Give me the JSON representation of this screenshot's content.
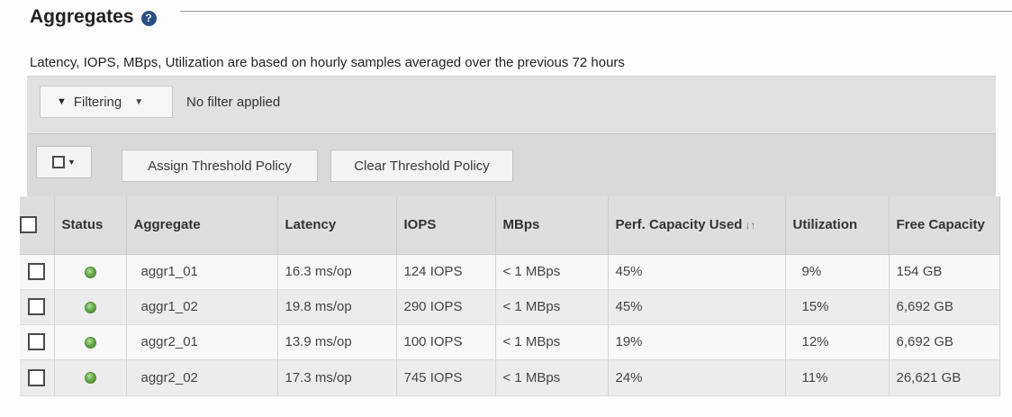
{
  "header": {
    "title": "Aggregates",
    "help_icon": "help-icon",
    "subtitle": "Latency, IOPS, MBps, Utilization are based on hourly samples averaged over the previous 72 hours"
  },
  "filter": {
    "button_label": "Filtering",
    "status": "No filter applied"
  },
  "actions": {
    "assign_label": "Assign Threshold Policy",
    "clear_label": "Clear Threshold Policy"
  },
  "table": {
    "columns": [
      "Status",
      "Aggregate",
      "Latency",
      "IOPS",
      "MBps",
      "Perf. Capacity Used",
      "Utilization",
      "Free Capacity"
    ],
    "rows": [
      {
        "status": "ok",
        "aggregate": "aggr1_01",
        "latency": "16.3 ms/op",
        "iops": "124 IOPS",
        "mbps": "< 1 MBps",
        "perf_capacity": "45%",
        "utilization": "9%",
        "free_capacity": "154 GB"
      },
      {
        "status": "ok",
        "aggregate": "aggr1_02",
        "latency": "19.8 ms/op",
        "iops": "290 IOPS",
        "mbps": "< 1 MBps",
        "perf_capacity": "45%",
        "utilization": "15%",
        "free_capacity": "6,692 GB"
      },
      {
        "status": "ok",
        "aggregate": "aggr2_01",
        "latency": "13.9 ms/op",
        "iops": "100 IOPS",
        "mbps": "< 1 MBps",
        "perf_capacity": "19%",
        "utilization": "12%",
        "free_capacity": "6,692 GB"
      },
      {
        "status": "ok",
        "aggregate": "aggr2_02",
        "latency": "17.3 ms/op",
        "iops": "745 IOPS",
        "mbps": "< 1 MBps",
        "perf_capacity": "24%",
        "utilization": "11%",
        "free_capacity": "26,621 GB"
      }
    ]
  },
  "colors": {
    "status_ok": "#6ab04c",
    "help_icon": "#2d4f86"
  }
}
